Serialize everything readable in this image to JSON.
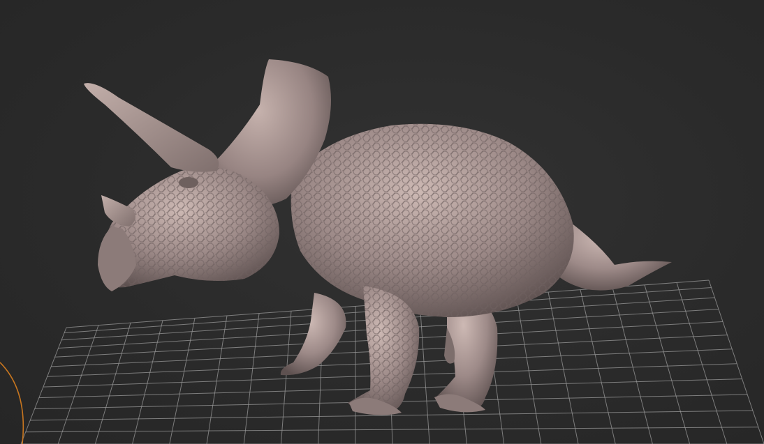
{
  "viewport": {
    "object": "triceratops-sculpt",
    "show_grid": true,
    "colors": {
      "background": "#2b2b2b",
      "grid_line": "#9a9a9a",
      "model_base": "#9d8a88",
      "model_highlight": "#cdb9b4",
      "model_shadow": "#5e5150",
      "gizmo_ring": "#c8761f"
    }
  }
}
